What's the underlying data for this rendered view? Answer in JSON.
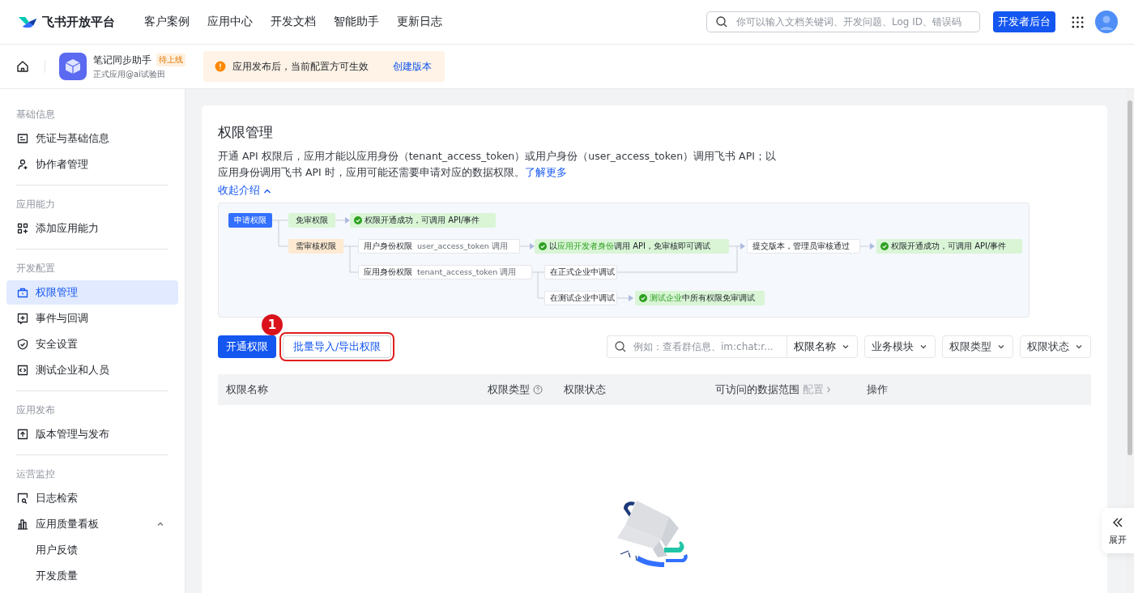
{
  "header": {
    "logo": "飞书开放平台",
    "nav": [
      "客户案例",
      "应用中心",
      "开发文档",
      "智能助手",
      "更新日志"
    ],
    "search": {
      "placeholder": "你可以输入文档关键词、开发问题、Log ID、错误码"
    },
    "console_button": "开发者后台"
  },
  "app_bar": {
    "name": "笔记同步助手",
    "badge": "待上线",
    "subtitle": "正式应用@ai试验田",
    "notice": "应用发布后，当前配置方可生效",
    "notice_link": "创建版本"
  },
  "sidebar": [
    {
      "title": "基础信息",
      "items": [
        {
          "label": "凭证与基础信息",
          "selected": false
        },
        {
          "label": "协作者管理",
          "selected": false
        }
      ]
    },
    {
      "title": "应用能力",
      "items": [
        {
          "label": "添加应用能力",
          "selected": false
        }
      ]
    },
    {
      "title": "开发配置",
      "items": [
        {
          "label": "权限管理",
          "selected": true
        },
        {
          "label": "事件与回调",
          "selected": false
        },
        {
          "label": "安全设置",
          "selected": false
        },
        {
          "label": "测试企业和人员",
          "selected": false
        }
      ]
    },
    {
      "title": "应用发布",
      "items": [
        {
          "label": "版本管理与发布",
          "selected": false
        }
      ]
    },
    {
      "title": "运营监控",
      "items": [
        {
          "label": "日志检索",
          "selected": false
        },
        {
          "label": "应用质量看板",
          "selected": false,
          "expanded": true,
          "children": [
            {
              "label": "用户反馈",
              "selected": false
            },
            {
              "label": "开发质量",
              "selected": false
            }
          ]
        }
      ]
    }
  ],
  "page": {
    "title": "权限管理",
    "description": "开通 API 权限后，应用才能以应用身份（tenant_access_token）或用户身份（user_access_token）调用飞书 API；以应用身份调用飞书 API 时，应用可能还需要申请对应的数据权限。",
    "learn_more": "了解更多",
    "collapse": "收起介绍"
  },
  "diagram": {
    "nodes": [
      {
        "kind": "start",
        "text": "申请权限"
      },
      {
        "kind": "free",
        "text": "免审权限"
      },
      {
        "kind": "result",
        "text": "权限开通成功，可调用 API/事件"
      },
      {
        "kind": "review",
        "text": "需审核权限"
      },
      {
        "kind": "step",
        "text": "用户身份权限",
        "note": "user_access_token 调用"
      },
      {
        "kind": "result",
        "text": "以**应用开发者身份**调用 API，免审核即可调试"
      },
      {
        "kind": "step",
        "text": "提交版本，管理员审核通过"
      },
      {
        "kind": "result",
        "text": "权限开通成功，可调用 API/事件"
      },
      {
        "kind": "step",
        "text": "应用身份权限",
        "note": "tenant_access_token 调用"
      },
      {
        "kind": "step",
        "text": "在正式企业中调试"
      },
      {
        "kind": "step",
        "text": "在测试企业中调试"
      },
      {
        "kind": "result",
        "text": "**测试企业**中所有权限免审调试"
      }
    ]
  },
  "toolbar": {
    "primary": "开通权限",
    "secondary": {
      "label": "批量导入/导出权限",
      "highlighted": true,
      "step": "1"
    },
    "search": {
      "placeholder": "例如：查看群信息、im:chat:r..."
    },
    "search_scope": "权限名称",
    "filters": [
      "业务模块",
      "权限类型",
      "权限状态"
    ]
  },
  "table": {
    "columns": [
      {
        "label": "权限名称"
      },
      {
        "label": "权限类型",
        "help": true
      },
      {
        "label": "权限状态"
      },
      {
        "label": "可访问的数据范围",
        "action": "配置"
      },
      {
        "label": "操作"
      }
    ]
  },
  "side_tab": {
    "label": "展开"
  }
}
